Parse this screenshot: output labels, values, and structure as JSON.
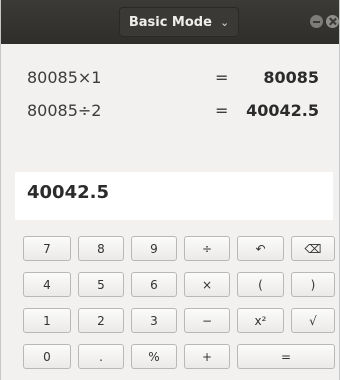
{
  "titlebar": {
    "mode_label": "Basic Mode",
    "mode_menu_icon": "chevron-down-icon",
    "window_controls": [
      "minimize-icon",
      "close-icon"
    ]
  },
  "history": [
    {
      "expression": "80085×1",
      "equals": "=",
      "result": "80085"
    },
    {
      "expression": "80085÷2",
      "equals": "=",
      "result": "40042.5"
    }
  ],
  "display": {
    "value": "40042.5"
  },
  "keypad": {
    "rows": [
      [
        "7",
        "8",
        "9",
        "÷",
        "↶",
        "⌫"
      ],
      [
        "4",
        "5",
        "6",
        "×",
        "(",
        ")"
      ],
      [
        "1",
        "2",
        "3",
        "−",
        "x²",
        "√"
      ],
      [
        "0",
        ".",
        "%",
        "+",
        "="
      ]
    ]
  }
}
